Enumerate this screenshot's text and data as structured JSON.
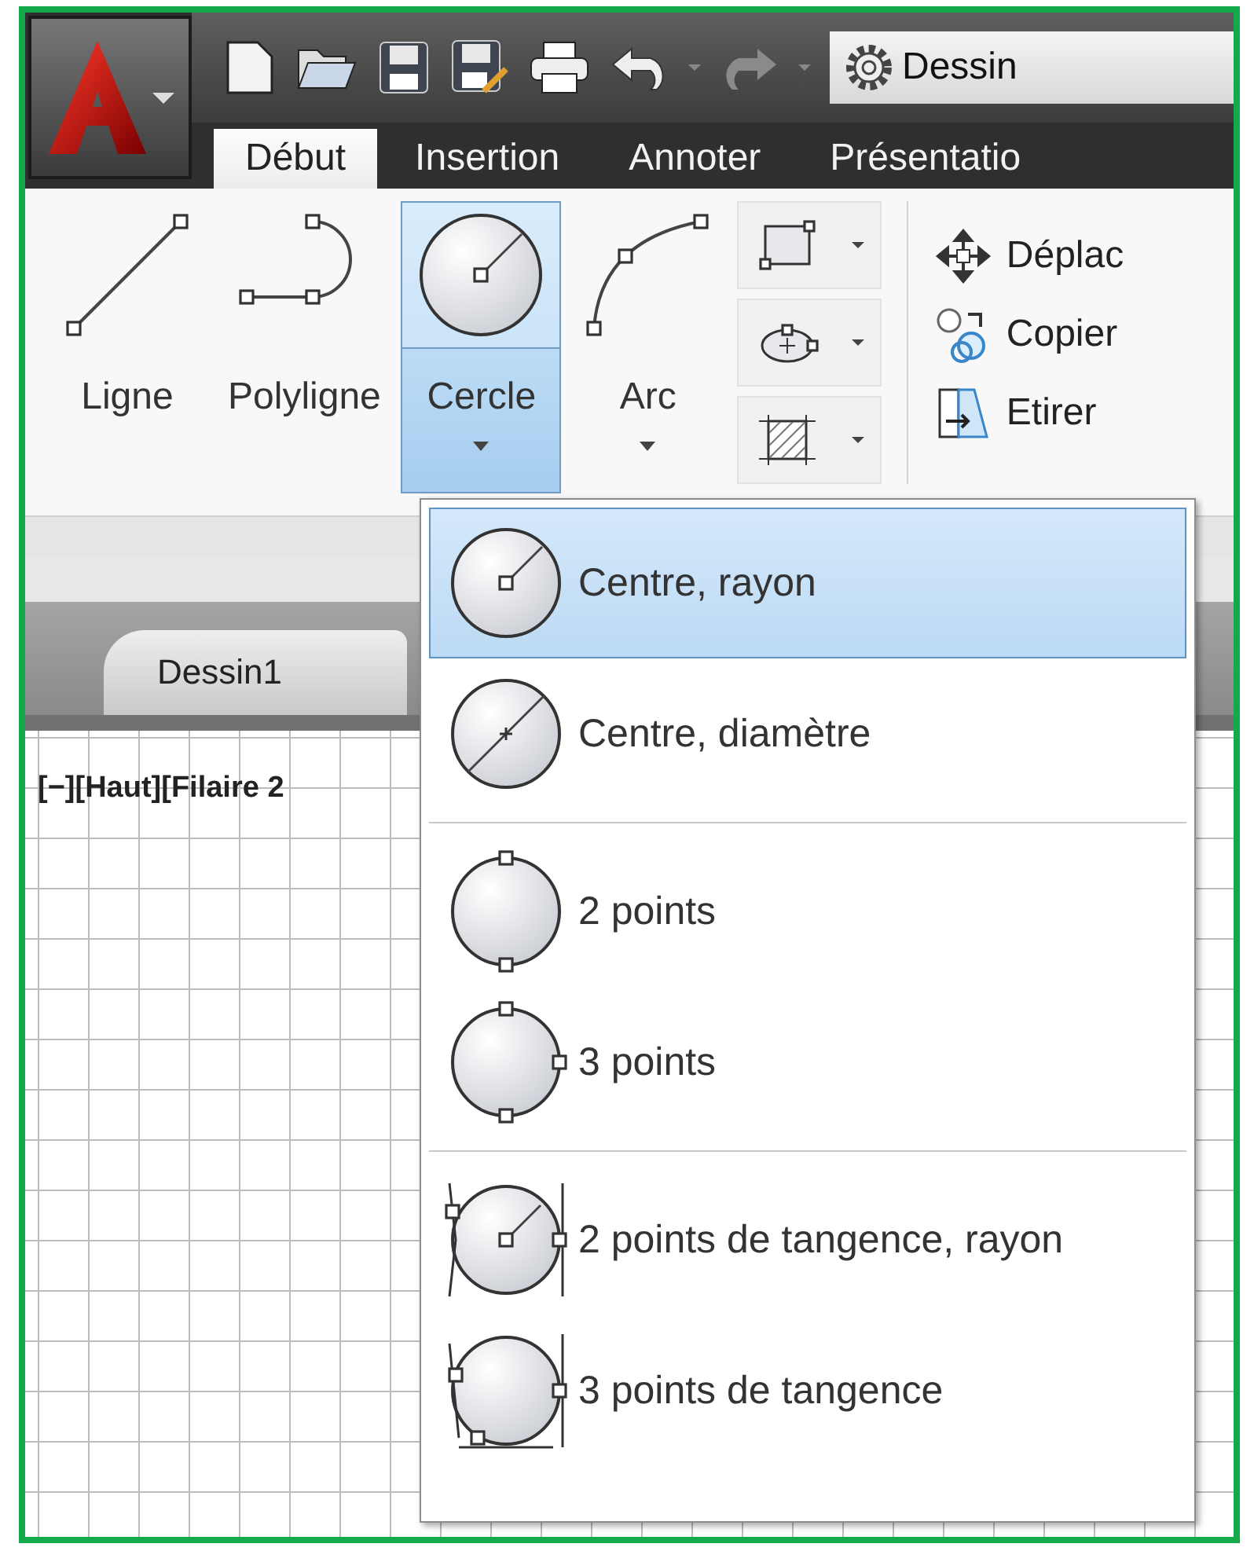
{
  "title_field": {
    "text": "Dessin"
  },
  "tabs": [
    {
      "label": "Début",
      "selected": true
    },
    {
      "label": "Insertion",
      "selected": false
    },
    {
      "label": "Annoter",
      "selected": false
    },
    {
      "label": "Présentatio",
      "selected": false
    }
  ],
  "ribbon": {
    "large_tools": [
      {
        "label": "Ligne",
        "expanded": false,
        "dropdown": false
      },
      {
        "label": "Polyligne",
        "expanded": false,
        "dropdown": false
      },
      {
        "label": "Cercle",
        "expanded": true,
        "dropdown": true
      },
      {
        "label": "Arc",
        "expanded": false,
        "dropdown": true
      }
    ],
    "modify_tools": [
      {
        "label": "Déplac"
      },
      {
        "label": "Copier"
      },
      {
        "label": "Etirer"
      }
    ]
  },
  "doc_tabs": [
    {
      "label": "Dessin1",
      "selected": true
    }
  ],
  "viewport": {
    "label": "[−][Haut][Filaire 2"
  },
  "circle_menu": {
    "groups": [
      [
        {
          "label": "Centre, rayon",
          "selected": true
        },
        {
          "label": "Centre, diamètre",
          "selected": false
        }
      ],
      [
        {
          "label": "2 points",
          "selected": false
        },
        {
          "label": "3 points",
          "selected": false
        }
      ],
      [
        {
          "label": "2 points de tangence, rayon",
          "selected": false
        },
        {
          "label": "3 points de tangence",
          "selected": false
        }
      ]
    ]
  }
}
